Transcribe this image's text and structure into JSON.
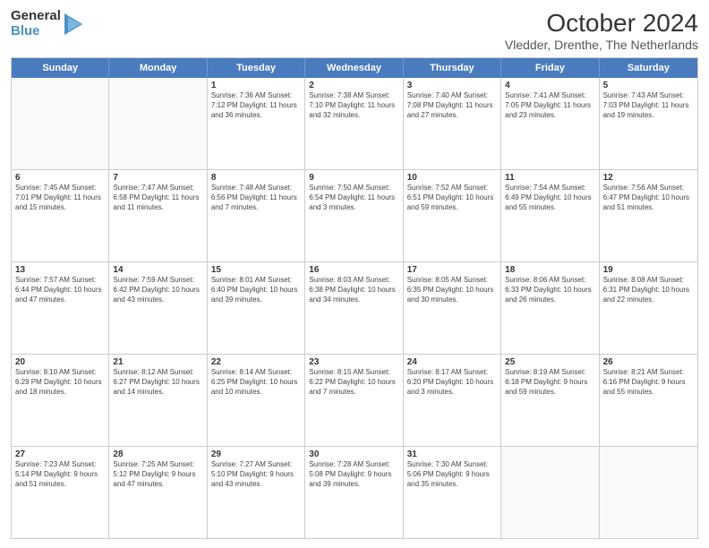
{
  "logo": {
    "general": "General",
    "blue": "Blue"
  },
  "title": "October 2024",
  "subtitle": "Vledder, Drenthe, The Netherlands",
  "weekdays": [
    "Sunday",
    "Monday",
    "Tuesday",
    "Wednesday",
    "Thursday",
    "Friday",
    "Saturday"
  ],
  "weeks": [
    [
      {
        "day": "",
        "info": ""
      },
      {
        "day": "",
        "info": ""
      },
      {
        "day": "1",
        "info": "Sunrise: 7:36 AM\nSunset: 7:12 PM\nDaylight: 11 hours and 36 minutes."
      },
      {
        "day": "2",
        "info": "Sunrise: 7:38 AM\nSunset: 7:10 PM\nDaylight: 11 hours and 32 minutes."
      },
      {
        "day": "3",
        "info": "Sunrise: 7:40 AM\nSunset: 7:08 PM\nDaylight: 11 hours and 27 minutes."
      },
      {
        "day": "4",
        "info": "Sunrise: 7:41 AM\nSunset: 7:05 PM\nDaylight: 11 hours and 23 minutes."
      },
      {
        "day": "5",
        "info": "Sunrise: 7:43 AM\nSunset: 7:03 PM\nDaylight: 11 hours and 19 minutes."
      }
    ],
    [
      {
        "day": "6",
        "info": "Sunrise: 7:45 AM\nSunset: 7:01 PM\nDaylight: 11 hours and 15 minutes."
      },
      {
        "day": "7",
        "info": "Sunrise: 7:47 AM\nSunset: 6:58 PM\nDaylight: 11 hours and 11 minutes."
      },
      {
        "day": "8",
        "info": "Sunrise: 7:48 AM\nSunset: 6:56 PM\nDaylight: 11 hours and 7 minutes."
      },
      {
        "day": "9",
        "info": "Sunrise: 7:50 AM\nSunset: 6:54 PM\nDaylight: 11 hours and 3 minutes."
      },
      {
        "day": "10",
        "info": "Sunrise: 7:52 AM\nSunset: 6:51 PM\nDaylight: 10 hours and 59 minutes."
      },
      {
        "day": "11",
        "info": "Sunrise: 7:54 AM\nSunset: 6:49 PM\nDaylight: 10 hours and 55 minutes."
      },
      {
        "day": "12",
        "info": "Sunrise: 7:56 AM\nSunset: 6:47 PM\nDaylight: 10 hours and 51 minutes."
      }
    ],
    [
      {
        "day": "13",
        "info": "Sunrise: 7:57 AM\nSunset: 6:44 PM\nDaylight: 10 hours and 47 minutes."
      },
      {
        "day": "14",
        "info": "Sunrise: 7:59 AM\nSunset: 6:42 PM\nDaylight: 10 hours and 43 minutes."
      },
      {
        "day": "15",
        "info": "Sunrise: 8:01 AM\nSunset: 6:40 PM\nDaylight: 10 hours and 39 minutes."
      },
      {
        "day": "16",
        "info": "Sunrise: 8:03 AM\nSunset: 6:38 PM\nDaylight: 10 hours and 34 minutes."
      },
      {
        "day": "17",
        "info": "Sunrise: 8:05 AM\nSunset: 6:35 PM\nDaylight: 10 hours and 30 minutes."
      },
      {
        "day": "18",
        "info": "Sunrise: 8:06 AM\nSunset: 6:33 PM\nDaylight: 10 hours and 26 minutes."
      },
      {
        "day": "19",
        "info": "Sunrise: 8:08 AM\nSunset: 6:31 PM\nDaylight: 10 hours and 22 minutes."
      }
    ],
    [
      {
        "day": "20",
        "info": "Sunrise: 8:10 AM\nSunset: 6:29 PM\nDaylight: 10 hours and 18 minutes."
      },
      {
        "day": "21",
        "info": "Sunrise: 8:12 AM\nSunset: 6:27 PM\nDaylight: 10 hours and 14 minutes."
      },
      {
        "day": "22",
        "info": "Sunrise: 8:14 AM\nSunset: 6:25 PM\nDaylight: 10 hours and 10 minutes."
      },
      {
        "day": "23",
        "info": "Sunrise: 8:15 AM\nSunset: 6:22 PM\nDaylight: 10 hours and 7 minutes."
      },
      {
        "day": "24",
        "info": "Sunrise: 8:17 AM\nSunset: 6:20 PM\nDaylight: 10 hours and 3 minutes."
      },
      {
        "day": "25",
        "info": "Sunrise: 8:19 AM\nSunset: 6:18 PM\nDaylight: 9 hours and 59 minutes."
      },
      {
        "day": "26",
        "info": "Sunrise: 8:21 AM\nSunset: 6:16 PM\nDaylight: 9 hours and 55 minutes."
      }
    ],
    [
      {
        "day": "27",
        "info": "Sunrise: 7:23 AM\nSunset: 5:14 PM\nDaylight: 9 hours and 51 minutes."
      },
      {
        "day": "28",
        "info": "Sunrise: 7:25 AM\nSunset: 5:12 PM\nDaylight: 9 hours and 47 minutes."
      },
      {
        "day": "29",
        "info": "Sunrise: 7:27 AM\nSunset: 5:10 PM\nDaylight: 9 hours and 43 minutes."
      },
      {
        "day": "30",
        "info": "Sunrise: 7:28 AM\nSunset: 5:08 PM\nDaylight: 9 hours and 39 minutes."
      },
      {
        "day": "31",
        "info": "Sunrise: 7:30 AM\nSunset: 5:06 PM\nDaylight: 9 hours and 35 minutes."
      },
      {
        "day": "",
        "info": ""
      },
      {
        "day": "",
        "info": ""
      }
    ]
  ]
}
